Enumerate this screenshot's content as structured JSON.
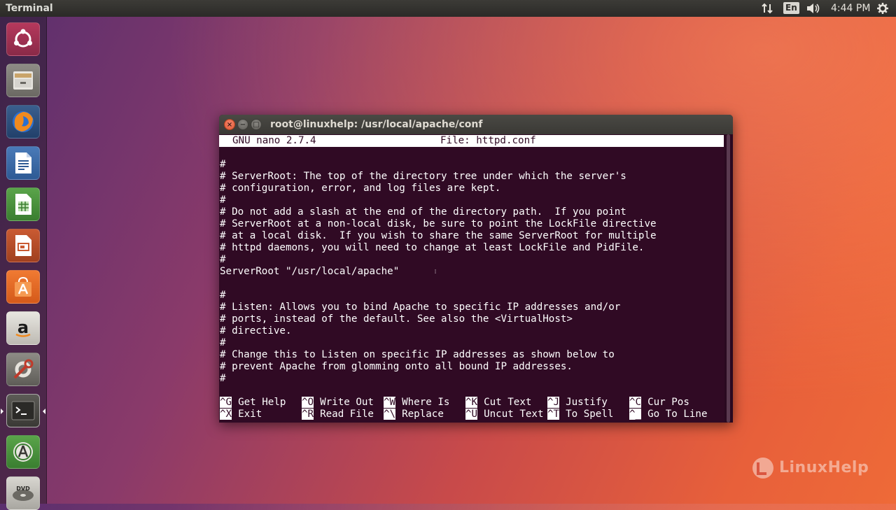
{
  "top_panel": {
    "title": "Terminal",
    "keyboard": "En",
    "time": "4:44 PM",
    "icons": [
      "network-arrows-icon",
      "keyboard-indicator",
      "volume-icon",
      "gear-icon"
    ]
  },
  "launcher": {
    "items": [
      {
        "name": "ubuntu-dash",
        "icon": "ubuntu-logo-icon"
      },
      {
        "name": "files",
        "icon": "file-cabinet-icon"
      },
      {
        "name": "firefox",
        "icon": "firefox-icon"
      },
      {
        "name": "libreoffice-writer",
        "icon": "writer-document-icon"
      },
      {
        "name": "libreoffice-calc",
        "icon": "calc-spreadsheet-icon"
      },
      {
        "name": "libreoffice-impress",
        "icon": "impress-presentation-icon"
      },
      {
        "name": "ubuntu-software",
        "icon": "software-bag-icon"
      },
      {
        "name": "amazon",
        "icon": "amazon-icon"
      },
      {
        "name": "system-settings",
        "icon": "settings-tools-icon"
      },
      {
        "name": "terminal",
        "icon": "terminal-icon"
      },
      {
        "name": "software-updater",
        "icon": "updater-icon"
      },
      {
        "name": "dvd",
        "icon": "dvd-icon"
      }
    ]
  },
  "window": {
    "title": "root@linuxhelp: /usr/local/apache/conf",
    "close": "×",
    "minimize": "−",
    "maximize": "□"
  },
  "nano": {
    "version": "GNU nano 2.7.4",
    "file": "File: httpd.conf",
    "lines": [
      "#",
      "# ServerRoot: The top of the directory tree under which the server's",
      "# configuration, error, and log files are kept.",
      "#",
      "# Do not add a slash at the end of the directory path.  If you point",
      "# ServerRoot at a non-local disk, be sure to point the LockFile directive",
      "# at a local disk.  If you wish to share the same ServerRoot for multiple",
      "# httpd daemons, you will need to change at least LockFile and PidFile.",
      "#",
      "ServerRoot \"/usr/local/apache\"",
      "",
      "#",
      "# Listen: Allows you to bind Apache to specific IP addresses and/or",
      "# ports, instead of the default. See also the <VirtualHost>",
      "# directive.",
      "#",
      "# Change this to Listen on specific IP addresses as shown below to",
      "# prevent Apache from glomming onto all bound IP addresses.",
      "#"
    ],
    "shortcuts_row1": [
      {
        "key": "^G",
        "label": "Get Help"
      },
      {
        "key": "^O",
        "label": "Write Out"
      },
      {
        "key": "^W",
        "label": "Where Is"
      },
      {
        "key": "^K",
        "label": "Cut Text"
      },
      {
        "key": "^J",
        "label": "Justify"
      },
      {
        "key": "^C",
        "label": "Cur Pos"
      }
    ],
    "shortcuts_row2": [
      {
        "key": "^X",
        "label": "Exit"
      },
      {
        "key": "^R",
        "label": "Read File"
      },
      {
        "key": "^\\",
        "label": "Replace"
      },
      {
        "key": "^U",
        "label": "Uncut Text"
      },
      {
        "key": "^T",
        "label": "To Spell"
      },
      {
        "key": "^_",
        "label": "Go To Line"
      }
    ]
  },
  "watermark": {
    "text": "LinuxHelp"
  }
}
